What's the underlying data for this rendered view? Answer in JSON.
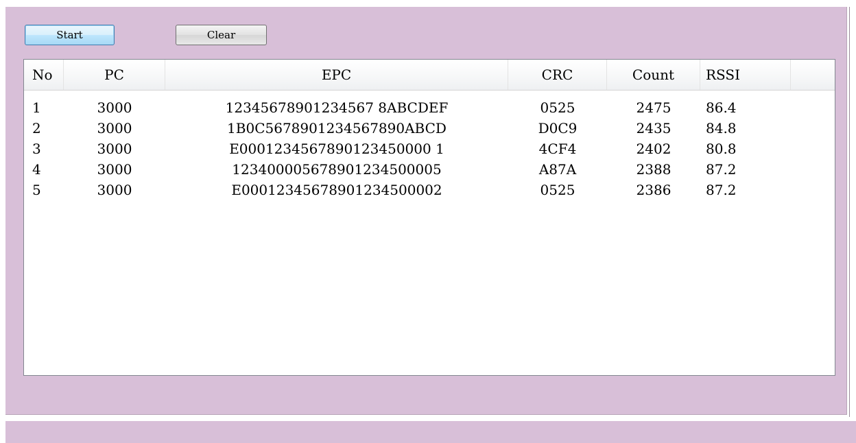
{
  "toolbar": {
    "start_label": "Start",
    "clear_label": "Clear"
  },
  "table": {
    "columns": [
      "No",
      "PC",
      "EPC",
      "CRC",
      "Count",
      "RSSI"
    ],
    "rows": [
      {
        "no": "1",
        "pc": "3000",
        "epc": "12345678901234567 8ABCDEF",
        "crc": "0525",
        "count": "2475",
        "rssi": "86.4"
      },
      {
        "no": "2",
        "pc": "3000",
        "epc": "1B0C5678901234567890ABCD",
        "crc": "D0C9",
        "count": "2435",
        "rssi": "84.8"
      },
      {
        "no": "3",
        "pc": "3000",
        "epc": "E0001234567890123450000 1",
        "crc": "4CF4",
        "count": "2402",
        "rssi": "80.8"
      },
      {
        "no": "4",
        "pc": "3000",
        "epc": "123400005678901234500005",
        "crc": "A87A",
        "count": "2388",
        "rssi": "87.2"
      },
      {
        "no": "5",
        "pc": "3000",
        "epc": "E00012345678901234500002",
        "crc": "0525",
        "count": "2386",
        "rssi": "87.2"
      }
    ]
  },
  "colors": {
    "panel_background": "#d8bfd8",
    "list_background": "#ffffff",
    "start_button_focus_border": "#3c7fb1"
  }
}
